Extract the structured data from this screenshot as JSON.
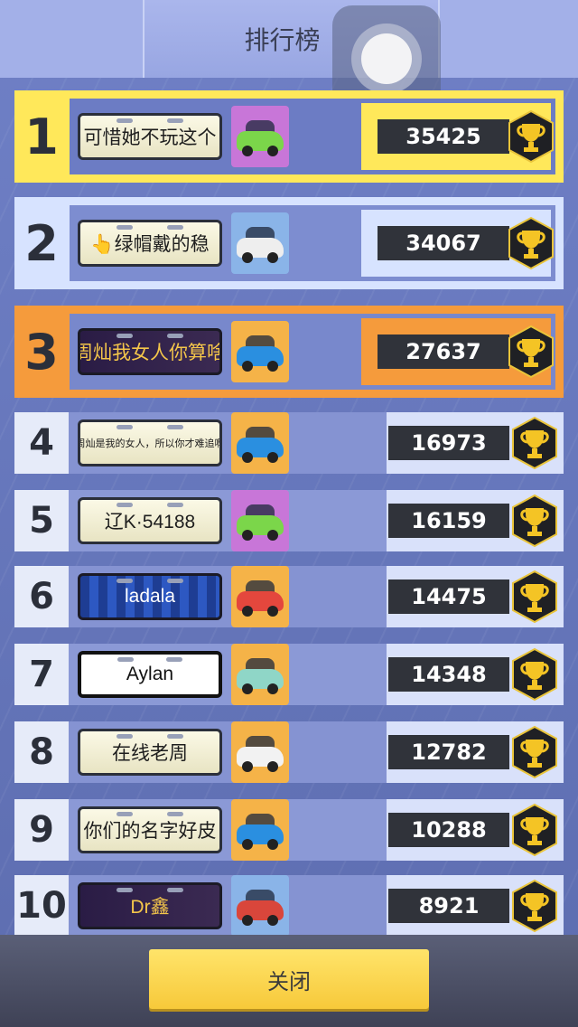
{
  "header": {
    "title": "排行榜"
  },
  "rows": [
    {
      "rank": "1",
      "name": "可惜她不玩这个",
      "score": "35425",
      "plate_style": "light",
      "car_color": "#7bd64a",
      "car_bg": "#c876d8",
      "row_theme": "gold"
    },
    {
      "rank": "2",
      "name": "👆绿帽戴的稳",
      "score": "34067",
      "plate_style": "light",
      "car_color": "#eeeeee",
      "car_bg": "#8ab4e8",
      "row_theme": "blue"
    },
    {
      "rank": "3",
      "name": "周灿我女人你算啥",
      "score": "27637",
      "plate_style": "dark",
      "car_color": "#2a8fe0",
      "car_bg": "#f5b348",
      "row_theme": "orange"
    },
    {
      "rank": "4",
      "name": "周灿是我的女人，所以你才难追啊",
      "score": "16973",
      "plate_style": "small",
      "car_color": "#2a8fe0",
      "car_bg": "#f5b348",
      "row_theme": "plain"
    },
    {
      "rank": "5",
      "name": "辽K·54188",
      "score": "16159",
      "plate_style": "light",
      "car_color": "#7bd64a",
      "car_bg": "#c876d8",
      "row_theme": "plain"
    },
    {
      "rank": "6",
      "name": "ladala",
      "score": "14475",
      "plate_style": "blue",
      "car_color": "#e4473d",
      "car_bg": "#f5b348",
      "row_theme": "plain"
    },
    {
      "rank": "7",
      "name": "Aylan",
      "score": "14348",
      "plate_style": "black",
      "car_color": "#8fd6c7",
      "car_bg": "#f5b348",
      "row_theme": "plain"
    },
    {
      "rank": "8",
      "name": "在线老周",
      "score": "12782",
      "plate_style": "light",
      "car_color": "#f2f2f2",
      "car_bg": "#f5b348",
      "row_theme": "plain"
    },
    {
      "rank": "9",
      "name": "你们的名字好皮",
      "score": "10288",
      "plate_style": "light",
      "car_color": "#2a8fe0",
      "car_bg": "#f5b348",
      "row_theme": "plain"
    },
    {
      "rank": "10",
      "name": "Dr鑫",
      "score": "8921",
      "plate_style": "dark",
      "car_color": "#d9463b",
      "car_bg": "#8ab4e8",
      "row_theme": "plain"
    }
  ],
  "footer": {
    "close_label": "关闭"
  },
  "colors": {
    "gold": "#ffe85a",
    "blue": "#d7e3ff",
    "orange": "#f59b3c",
    "score_bg": "#30333a"
  }
}
